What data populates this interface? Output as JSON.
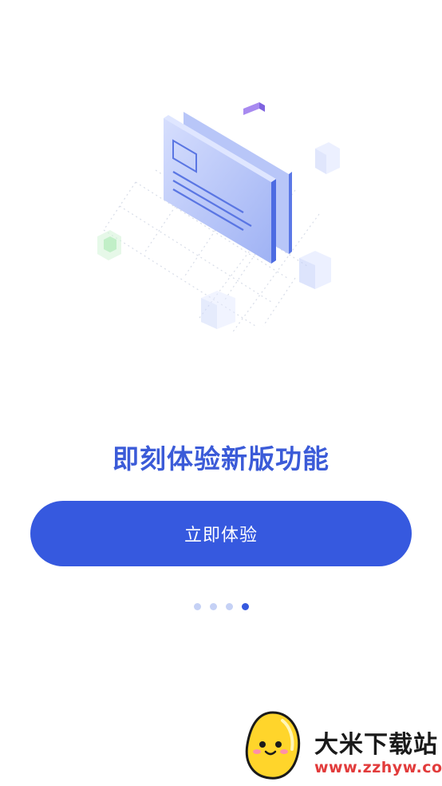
{
  "onboarding": {
    "headline": "即刻体验新版功能",
    "cta_label": "立即体验",
    "pager": {
      "total": 4,
      "active_index": 3
    }
  },
  "watermark": {
    "name": "大米下载站",
    "url": "www.zzhyw.com"
  },
  "colors": {
    "primary": "#3659df",
    "headline": "#3b5bd8",
    "dot_inactive": "#c5d1f5",
    "watermark_url": "#e23b3b"
  },
  "icons": {
    "illustration": "document-cards-illustration",
    "watermark_logo": "mascot-logo-icon"
  }
}
